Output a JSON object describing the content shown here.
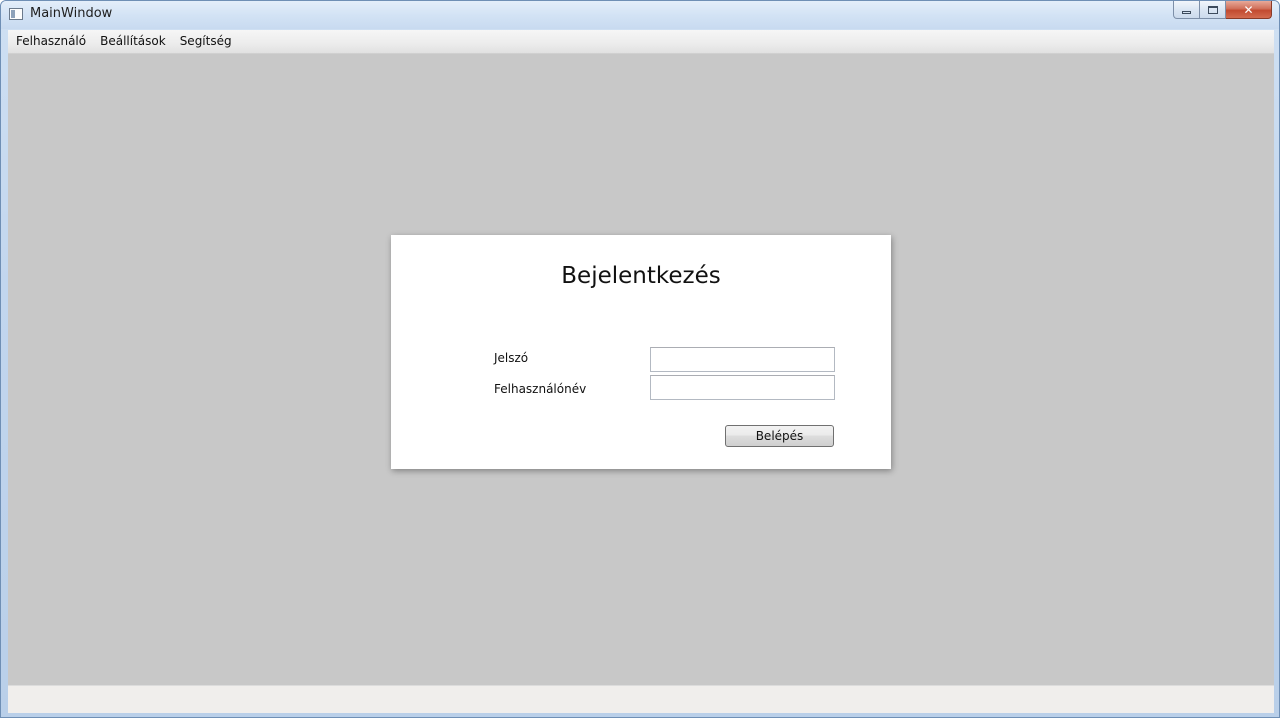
{
  "window": {
    "title": "MainWindow",
    "icon": "app-window-icon",
    "caption_buttons": {
      "minimize": "minimize-icon",
      "maximize": "maximize-icon",
      "close": "close-icon",
      "close_glyph": "✕"
    }
  },
  "menu": {
    "items": [
      {
        "label": "Felhasználó"
      },
      {
        "label": "Beállítások"
      },
      {
        "label": "Segítség"
      }
    ]
  },
  "login": {
    "title": "Bejelentkezés",
    "password_label": "Jelszó",
    "password_value": "",
    "username_label": "Felhasználónév",
    "username_value": "",
    "submit_label": "Belépés"
  },
  "colors": {
    "workspace_background": "#c8c8c8",
    "card_background": "#ffffff",
    "statusbar_background": "#f0eeec"
  }
}
